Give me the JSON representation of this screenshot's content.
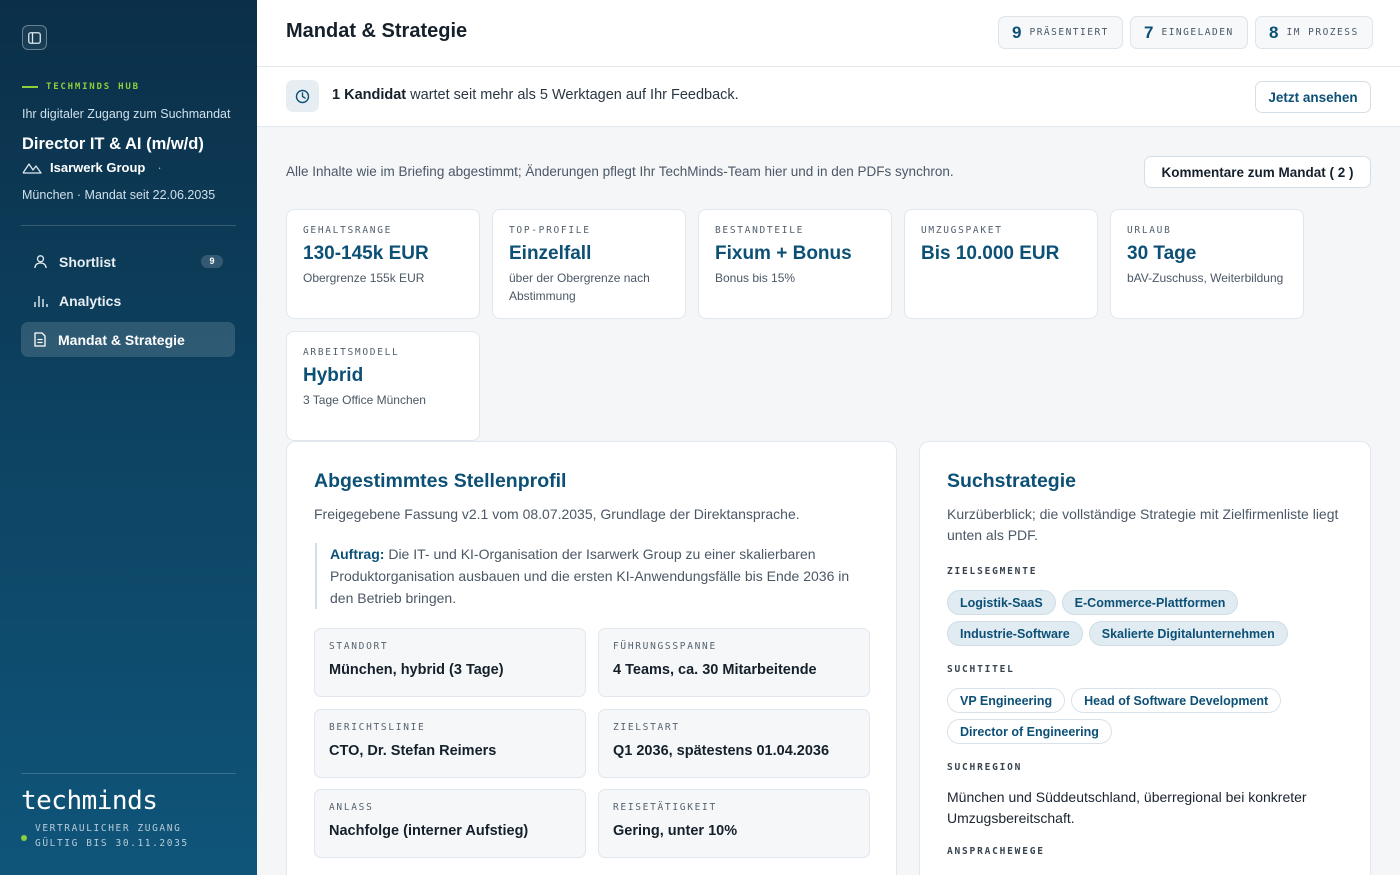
{
  "sidebar": {
    "hub_label": "TECHMINDS HUB",
    "hub_sub": "Ihr digitaler Zugang zum Suchmandat",
    "role_title": "Director IT & AI (m/w/d)",
    "company": "Isarwerk Group",
    "company_sep": "·",
    "location_line": "München · Mandat seit 22.06.2035",
    "nav": [
      {
        "label": "Shortlist",
        "icon": "user-icon",
        "badge": "9"
      },
      {
        "label": "Analytics",
        "icon": "bar-chart-icon"
      },
      {
        "label": "Mandat & Strategie",
        "icon": "document-icon",
        "active": true
      }
    ],
    "brand": "techminds",
    "access_line1": "VERTRAULICHER ZUGANG",
    "access_line2": "GÜLTIG BIS 30.11.2035"
  },
  "header": {
    "title": "Mandat & Strategie",
    "stats": [
      {
        "num": "9",
        "label": "PRÄSENTIERT"
      },
      {
        "num": "7",
        "label": "EINGELADEN"
      },
      {
        "num": "8",
        "label": "IM PROZESS"
      }
    ]
  },
  "banner": {
    "bold": "1 Kandidat",
    "text": " wartet seit mehr als 5 Werktagen auf Ihr Feedback.",
    "button": "Jetzt ansehen"
  },
  "intro": "Alle Inhalte wie im Briefing abgestimmt; Änderungen pflegt Ihr TechMinds-Team hier und in den PDFs synchron.",
  "comments_button": "Kommentare zum Mandat (  2  )",
  "kpis": [
    {
      "label": "GEHALTSRANGE",
      "value": "130-145k EUR",
      "sub": "Obergrenze 155k EUR"
    },
    {
      "label": "TOP-PROFILE",
      "value": "Einzelfall",
      "sub": "über der Obergrenze nach Abstimmung"
    },
    {
      "label": "BESTANDTEILE",
      "value": "Fixum + Bonus",
      "sub": "Bonus bis 15%"
    },
    {
      "label": "UMZUGSPAKET",
      "value": "Bis 10.000 EUR",
      "sub": ""
    },
    {
      "label": "URLAUB",
      "value": "30 Tage",
      "sub": "bAV-Zuschuss, Weiterbildung"
    },
    {
      "label": "ARBEITSMODELL",
      "value": "Hybrid",
      "sub": "3 Tage Office München"
    }
  ],
  "profile": {
    "title": "Abgestimmtes Stellenprofil",
    "desc": "Freigegebene Fassung v2.1 vom 08.07.2035, Grundlage der Direktansprache.",
    "mandate_label": "Auftrag:",
    "mandate_text": " Die IT- und KI-Organisation der Isarwerk Group zu einer skalierbaren Produktorganisation ausbauen und die ersten KI-Anwendungsfälle bis Ende 2036 in den Betrieb bringen.",
    "facts": [
      {
        "label": "STANDORT",
        "value": "München, hybrid (3 Tage)"
      },
      {
        "label": "FÜHRUNGSSPANNE",
        "value": "4 Teams, ca. 30 Mitarbeitende"
      },
      {
        "label": "BERICHTSLINIE",
        "value": "CTO, Dr. Stefan Reimers"
      },
      {
        "label": "ZIELSTART",
        "value": "Q1 2036, spätestens 01.04.2036"
      },
      {
        "label": "ANLASS",
        "value": "Nachfolge (interner Aufstieg)"
      },
      {
        "label": "REISETÄTIGKEIT",
        "value": "Gering, unter 10%"
      }
    ]
  },
  "strategy": {
    "title": "Suchstrategie",
    "desc": "Kurzüberblick; die vollständige Strategie mit Zielfirmenliste liegt unten als PDF.",
    "segments_label": "ZIELSEGMENTE",
    "segments": [
      "Logistik-SaaS",
      "E-Commerce-Plattformen",
      "Industrie-Software",
      "Skalierte Digitalunternehmen"
    ],
    "titles_label": "SUCHTITEL",
    "titles": [
      "VP Engineering",
      "Head of Software Development",
      "Director of Engineering"
    ],
    "region_label": "SUCHREGION",
    "region_text": "München und Süddeutschland, überregional bei konkreter Umzugsbereitschaft.",
    "channels_label": "ANSPRACHEWEGE"
  }
}
